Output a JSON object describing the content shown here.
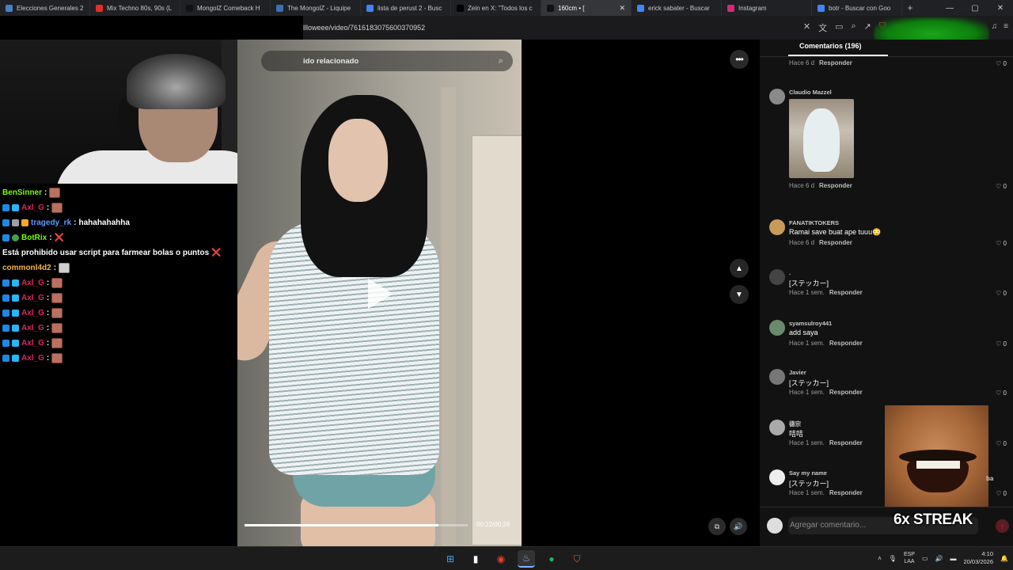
{
  "browser": {
    "tabs": [
      {
        "title": "Elecciones Generales 2",
        "color": "#4a7fc1"
      },
      {
        "title": "Mix Techno 80s, 90s (L",
        "color": "#e52d27"
      },
      {
        "title": "MongolZ Comeback H",
        "color": "#111111"
      },
      {
        "title": "The MongolZ - Liquipe",
        "color": "#3b6fb6"
      },
      {
        "title": "lista de perust 2 - Busc",
        "color": "#4285f4"
      },
      {
        "title": "Zein en X: \"Todos los c",
        "color": "#000000"
      },
      {
        "title": "160cm • [",
        "color": "#111111",
        "active": true
      },
      {
        "title": "erick sabater - Buscar",
        "color": "#4285f4"
      },
      {
        "title": "Instagram",
        "color": "#d62976"
      },
      {
        "title": "botr - Buscar con Goo",
        "color": "#4285f4"
      }
    ],
    "url": "llloweee/video/7616183075600370952"
  },
  "chat": {
    "messages": [
      {
        "user": "BenSinner",
        "color": "#7cfc00",
        "badges": [],
        "text": "",
        "emotes": 1
      },
      {
        "user": "Axl_G",
        "color": "#e0245e",
        "badges": [
          "b1",
          "b2"
        ],
        "text": "",
        "emotes": 1
      },
      {
        "user": "tragedy_rk",
        "color": "#5b9bff",
        "badges": [
          "b1",
          "b3",
          "b4"
        ],
        "text": "hahahahahha",
        "emotes": 0
      },
      {
        "user": "BotRix",
        "color": "#7cfc00",
        "badges": [
          "b1",
          "b5"
        ],
        "text": "Está prohibido usar script para farmear bolas o puntos",
        "emotes": 0,
        "cross": "❌"
      },
      {
        "user": "commonl4d2",
        "color": "#f5b342",
        "badges": [],
        "text": "",
        "emotes": 1,
        "emoteType": "cat"
      },
      {
        "user": "Axl_G",
        "color": "#e0245e",
        "badges": [
          "b1",
          "b2"
        ],
        "text": "",
        "emotes": 1
      },
      {
        "user": "Axl_G",
        "color": "#e0245e",
        "badges": [
          "b1",
          "b2"
        ],
        "text": "",
        "emotes": 1
      },
      {
        "user": "Axl_G",
        "color": "#e0245e",
        "badges": [
          "b1",
          "b2"
        ],
        "text": "",
        "emotes": 1
      },
      {
        "user": "Axl_G",
        "color": "#e0245e",
        "badges": [
          "b1",
          "b2"
        ],
        "text": "",
        "emotes": 1
      },
      {
        "user": "Axl_G",
        "color": "#e0245e",
        "badges": [
          "b1",
          "b2"
        ],
        "text": "",
        "emotes": 1
      },
      {
        "user": "Axl_G",
        "color": "#e0245e",
        "badges": [
          "b1",
          "b2"
        ],
        "text": "",
        "emotes": 1
      }
    ]
  },
  "video": {
    "search_text": "ido relacionado",
    "time": "00:22/00:26",
    "progress": 0.87
  },
  "comments": {
    "tab_label": "Comentarios (196)",
    "reply_label": "Responder",
    "items": [
      {
        "user": "",
        "text": "",
        "time": "Hace 6 d",
        "likes": "0"
      },
      {
        "user": "Claudio Mazzel",
        "text": "",
        "time": "Hace 6 d",
        "likes": "0",
        "image": true
      },
      {
        "user": "FANATIKTOKERS",
        "text": "Ramai save buat ape tuuu😳",
        "time": "Hace 6 d",
        "likes": "0"
      },
      {
        "user": ".",
        "text": "[ステッカー]",
        "time": "Hace 1 sem.",
        "likes": "0"
      },
      {
        "user": "syamsulroy441",
        "text": "add saya",
        "time": "Hace 1 sem.",
        "likes": "0"
      },
      {
        "user": "Javier",
        "text": "[ステッカー]",
        "time": "Hace 1 sem.",
        "likes": "0"
      },
      {
        "user": "德宗",
        "text": "咭咭",
        "time": "Hace 1 sem.",
        "likes": "0"
      },
      {
        "user": "Say my name",
        "text": "[ステッカー]",
        "time": "Hace 1 sem.",
        "likes": "0"
      }
    ],
    "add_placeholder": "Agregar comentario...",
    "side_label": "ba"
  },
  "overlay": {
    "streak": "6x STREAK"
  },
  "taskbar": {
    "lang_top": "ESP",
    "lang_bottom": "LAA",
    "time": "4:10",
    "date": "20/03/2026"
  }
}
